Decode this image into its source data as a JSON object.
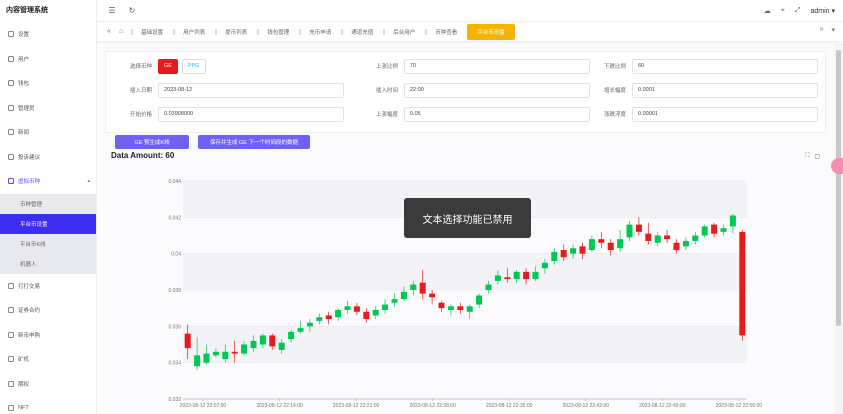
{
  "app": {
    "title": "内容管理系统"
  },
  "topbar": {
    "user": "admin"
  },
  "sidebar": {
    "items": [
      {
        "label": "设置"
      },
      {
        "label": "用户"
      },
      {
        "label": "钱包"
      },
      {
        "label": "管理员"
      },
      {
        "label": "新闻"
      },
      {
        "label": "投诉建议"
      },
      {
        "label": "虚拟币种",
        "active": true
      },
      {
        "label": "打打交易"
      },
      {
        "label": "证券合约"
      },
      {
        "label": "新币申购"
      },
      {
        "label": "矿机"
      },
      {
        "label": "期权"
      },
      {
        "label": "NFT"
      }
    ],
    "submenu": [
      {
        "label": "币种管理"
      },
      {
        "label": "平台币设置",
        "active": true
      },
      {
        "label": "平台币K线"
      },
      {
        "label": "机器人"
      }
    ]
  },
  "tabs": [
    {
      "label": "基础设置"
    },
    {
      "label": "用户列表"
    },
    {
      "label": "提币列表"
    },
    {
      "label": "钱包管理"
    },
    {
      "label": "充币申请"
    },
    {
      "label": "通道充值"
    },
    {
      "label": "后台用户"
    },
    {
      "label": "币种查看"
    },
    {
      "label": "平台币设置",
      "active": true
    }
  ],
  "form": {
    "coin_label": "选择币种",
    "coin_options": [
      {
        "label": "GE",
        "selected": true
      },
      {
        "label": "PPG",
        "selected": false
      }
    ],
    "date_label": "插入日期",
    "date_value": "2023-08-12",
    "open_price_label": "开始价格",
    "open_price_value": "0.03908000",
    "rise_ratio_label": "上涨比例",
    "rise_ratio_value": "70",
    "time_label": "插入时间",
    "time_value": "22:00",
    "rise_range_label": "上涨幅度",
    "rise_range_value": "0.05",
    "fall_ratio_label": "下跌比例",
    "fall_ratio_value": "60",
    "volatility_label": "增长幅度",
    "volatility_value": "0.0001",
    "float_label": "涨跌浮度",
    "float_value": "0.00001"
  },
  "buttons": {
    "preview": "GE 预生成K线",
    "save": "保存并生成 GE 下一个时间段的数据"
  },
  "amount_text": "Data Amount: 60",
  "toast_text": "文本选择功能已禁用",
  "colors": {
    "up": "#00c853",
    "down": "#e61c1c",
    "accent": "#5b4cf5",
    "tab_active": "#f3b300"
  },
  "chart_data": {
    "type": "candlestick",
    "title": "",
    "x_ticks": [
      "2023-08-12 22:07:00",
      "2023-08-12 22:14:00",
      "2023-08-12 22:21:00",
      "2023-08-12 22:28:00",
      "2023-08-12 22:35:00",
      "2023-08-12 22:42:00",
      "2023-08-12 22:49:00",
      "2023-08-12 22:56:00"
    ],
    "y_ticks": [
      "0.044",
      "0.042",
      "0.04",
      "0.038",
      "0.036",
      "0.034",
      "0.032"
    ],
    "ylim": [
      0.032,
      0.044
    ],
    "candles": [
      {
        "o": 0.0356,
        "c": 0.0348,
        "h": 0.0361,
        "l": 0.0342
      },
      {
        "o": 0.0338,
        "c": 0.0344,
        "h": 0.0354,
        "l": 0.0336
      },
      {
        "o": 0.034,
        "c": 0.0345,
        "h": 0.035,
        "l": 0.0339
      },
      {
        "o": 0.0344,
        "c": 0.0346,
        "h": 0.0348,
        "l": 0.0343
      },
      {
        "o": 0.0342,
        "c": 0.0346,
        "h": 0.035,
        "l": 0.034
      },
      {
        "o": 0.0346,
        "c": 0.0345,
        "h": 0.0352,
        "l": 0.034
      },
      {
        "o": 0.0345,
        "c": 0.035,
        "h": 0.0352,
        "l": 0.0344
      },
      {
        "o": 0.0348,
        "c": 0.0352,
        "h": 0.0355,
        "l": 0.0346
      },
      {
        "o": 0.035,
        "c": 0.0355,
        "h": 0.0356,
        "l": 0.0348
      },
      {
        "o": 0.0355,
        "c": 0.0349,
        "h": 0.0356,
        "l": 0.0347
      },
      {
        "o": 0.0347,
        "c": 0.0351,
        "h": 0.0353,
        "l": 0.0345
      },
      {
        "o": 0.0353,
        "c": 0.0357,
        "h": 0.0358,
        "l": 0.0351
      },
      {
        "o": 0.0357,
        "c": 0.0359,
        "h": 0.0363,
        "l": 0.0356
      },
      {
        "o": 0.036,
        "c": 0.0362,
        "h": 0.0364,
        "l": 0.0357
      },
      {
        "o": 0.0363,
        "c": 0.0365,
        "h": 0.0367,
        "l": 0.0361
      },
      {
        "o": 0.0366,
        "c": 0.0364,
        "h": 0.0368,
        "l": 0.0361
      },
      {
        "o": 0.0365,
        "c": 0.0369,
        "h": 0.037,
        "l": 0.0363
      },
      {
        "o": 0.0369,
        "c": 0.0371,
        "h": 0.0374,
        "l": 0.0367
      },
      {
        "o": 0.0371,
        "c": 0.0368,
        "h": 0.0373,
        "l": 0.0366
      },
      {
        "o": 0.0368,
        "c": 0.0364,
        "h": 0.037,
        "l": 0.0362
      },
      {
        "o": 0.0366,
        "c": 0.0369,
        "h": 0.0371,
        "l": 0.0364
      },
      {
        "o": 0.0369,
        "c": 0.0372,
        "h": 0.0375,
        "l": 0.0367
      },
      {
        "o": 0.0373,
        "c": 0.0375,
        "h": 0.0378,
        "l": 0.0371
      },
      {
        "o": 0.0375,
        "c": 0.0379,
        "h": 0.0382,
        "l": 0.0374
      },
      {
        "o": 0.038,
        "c": 0.0383,
        "h": 0.0385,
        "l": 0.0377
      },
      {
        "o": 0.0384,
        "c": 0.0378,
        "h": 0.0391,
        "l": 0.0375
      },
      {
        "o": 0.0378,
        "c": 0.0376,
        "h": 0.038,
        "l": 0.0372
      },
      {
        "o": 0.0373,
        "c": 0.037,
        "h": 0.0374,
        "l": 0.0368
      },
      {
        "o": 0.0369,
        "c": 0.0371,
        "h": 0.0372,
        "l": 0.0366
      },
      {
        "o": 0.0371,
        "c": 0.0369,
        "h": 0.0373,
        "l": 0.0367
      },
      {
        "o": 0.0368,
        "c": 0.0371,
        "h": 0.0372,
        "l": 0.0364
      },
      {
        "o": 0.0372,
        "c": 0.0377,
        "h": 0.0378,
        "l": 0.037
      },
      {
        "o": 0.038,
        "c": 0.0383,
        "h": 0.0385,
        "l": 0.0378
      },
      {
        "o": 0.0385,
        "c": 0.0388,
        "h": 0.0391,
        "l": 0.0383
      },
      {
        "o": 0.0387,
        "c": 0.0386,
        "h": 0.0392,
        "l": 0.0384
      },
      {
        "o": 0.0386,
        "c": 0.039,
        "h": 0.0391,
        "l": 0.0384
      },
      {
        "o": 0.039,
        "c": 0.0386,
        "h": 0.0392,
        "l": 0.0383
      },
      {
        "o": 0.0386,
        "c": 0.039,
        "h": 0.0393,
        "l": 0.0385
      },
      {
        "o": 0.0392,
        "c": 0.0395,
        "h": 0.0397,
        "l": 0.0389
      },
      {
        "o": 0.0396,
        "c": 0.0401,
        "h": 0.0403,
        "l": 0.0394
      },
      {
        "o": 0.0402,
        "c": 0.0398,
        "h": 0.0405,
        "l": 0.0396
      },
      {
        "o": 0.04,
        "c": 0.0403,
        "h": 0.0405,
        "l": 0.0397
      },
      {
        "o": 0.0404,
        "c": 0.04,
        "h": 0.0406,
        "l": 0.0397
      },
      {
        "o": 0.0402,
        "c": 0.0408,
        "h": 0.041,
        "l": 0.0401
      },
      {
        "o": 0.0408,
        "c": 0.0406,
        "h": 0.0412,
        "l": 0.0403
      },
      {
        "o": 0.0406,
        "c": 0.0402,
        "h": 0.0408,
        "l": 0.0399
      },
      {
        "o": 0.0403,
        "c": 0.0408,
        "h": 0.0413,
        "l": 0.0401
      },
      {
        "o": 0.0409,
        "c": 0.0416,
        "h": 0.0418,
        "l": 0.0407
      },
      {
        "o": 0.0416,
        "c": 0.0412,
        "h": 0.042,
        "l": 0.041
      },
      {
        "o": 0.0411,
        "c": 0.0407,
        "h": 0.0417,
        "l": 0.0405
      },
      {
        "o": 0.0406,
        "c": 0.041,
        "h": 0.0412,
        "l": 0.0404
      },
      {
        "o": 0.041,
        "c": 0.0408,
        "h": 0.0413,
        "l": 0.0406
      },
      {
        "o": 0.0406,
        "c": 0.0402,
        "h": 0.0408,
        "l": 0.04
      },
      {
        "o": 0.0404,
        "c": 0.0407,
        "h": 0.0409,
        "l": 0.0402
      },
      {
        "o": 0.0407,
        "c": 0.041,
        "h": 0.0412,
        "l": 0.0405
      },
      {
        "o": 0.041,
        "c": 0.0415,
        "h": 0.0416,
        "l": 0.0409
      },
      {
        "o": 0.0416,
        "c": 0.0411,
        "h": 0.0417,
        "l": 0.0409
      },
      {
        "o": 0.0412,
        "c": 0.0414,
        "h": 0.0416,
        "l": 0.041
      },
      {
        "o": 0.0415,
        "c": 0.0421,
        "h": 0.0422,
        "l": 0.0411
      },
      {
        "o": 0.0412,
        "c": 0.0355,
        "h": 0.0413,
        "l": 0.0352
      }
    ]
  }
}
